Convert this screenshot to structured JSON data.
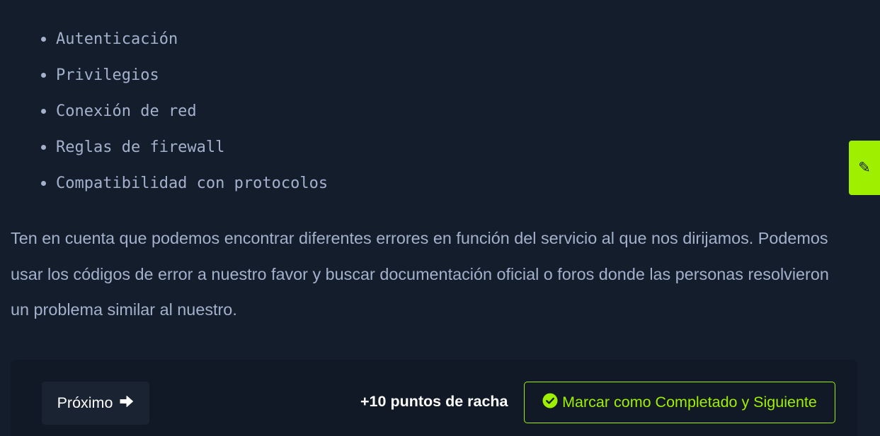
{
  "bullets": [
    "Autenticación",
    "Privilegios",
    "Conexión de red",
    "Reglas de firewall",
    "Compatibilidad con protocolos"
  ],
  "paragraph": "Ten en cuenta que podemos encontrar diferentes errores en función del servicio al que nos dirijamos. Podemos usar los códigos de error a nuestro favor y buscar documentación oficial o foros donde las personas resolvieron un problema similar al nuestro.",
  "side_tab": {
    "icon": "pencil-icon"
  },
  "footer": {
    "next_label": "Próximo",
    "next_icon": "arrow-right-icon",
    "streak_text": "+10 puntos de racha",
    "complete_label": "Marcar como Completado y Siguiente",
    "complete_icon": "check-circle-icon"
  },
  "colors": {
    "background": "#141d2b",
    "footer_background": "#111927",
    "accent": "#9fef00",
    "text": "#a4b1cd"
  }
}
